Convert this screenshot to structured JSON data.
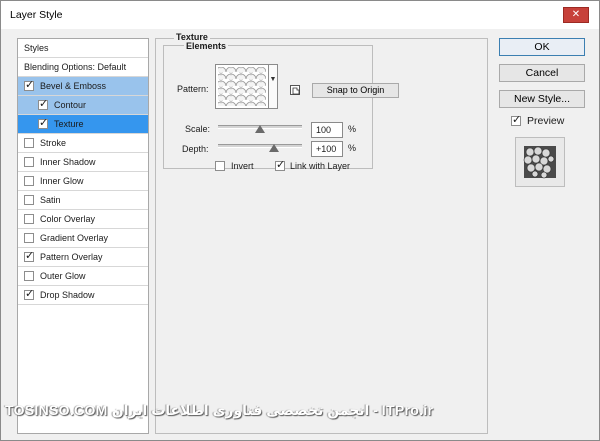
{
  "window": {
    "title": "Layer Style",
    "close_label": "✕"
  },
  "styles_panel": {
    "header": "Styles",
    "blending": "Blending Options: Default",
    "items": [
      {
        "label": "Bevel & Emboss",
        "checked": true,
        "indent": 0,
        "state": "selected-light"
      },
      {
        "label": "Contour",
        "checked": true,
        "indent": 1,
        "state": "selected-light"
      },
      {
        "label": "Texture",
        "checked": true,
        "indent": 1,
        "state": "selected"
      },
      {
        "label": "Stroke",
        "checked": false,
        "indent": 0,
        "state": ""
      },
      {
        "label": "Inner Shadow",
        "checked": false,
        "indent": 0,
        "state": ""
      },
      {
        "label": "Inner Glow",
        "checked": false,
        "indent": 0,
        "state": ""
      },
      {
        "label": "Satin",
        "checked": false,
        "indent": 0,
        "state": ""
      },
      {
        "label": "Color Overlay",
        "checked": false,
        "indent": 0,
        "state": ""
      },
      {
        "label": "Gradient Overlay",
        "checked": false,
        "indent": 0,
        "state": ""
      },
      {
        "label": "Pattern Overlay",
        "checked": true,
        "indent": 0,
        "state": ""
      },
      {
        "label": "Outer Glow",
        "checked": false,
        "indent": 0,
        "state": ""
      },
      {
        "label": "Drop Shadow",
        "checked": true,
        "indent": 0,
        "state": ""
      }
    ]
  },
  "texture": {
    "group_title": "Texture",
    "elements_title": "Elements",
    "pattern_label": "Pattern:",
    "snap_button": "Snap to Origin",
    "scale_label": "Scale:",
    "scale_value": "100",
    "scale_percent": 100,
    "depth_label": "Depth:",
    "depth_value": "+100",
    "depth_percent": 100,
    "percent_sign": "%",
    "invert_label": "Invert",
    "invert_checked": false,
    "link_label": "Link with Layer",
    "link_checked": true
  },
  "buttons": {
    "ok": "OK",
    "cancel": "Cancel",
    "new_style": "New Style..."
  },
  "preview": {
    "label": "Preview",
    "checked": true
  },
  "watermark": {
    "text": "TOSINSO.COM انجمن تخصصی فناوری اطلاعات ایران - ITPro.ir"
  },
  "colors": {
    "selection": "#3596ee",
    "selection_light": "#99c3ec",
    "accent_border": "#3c7fb1"
  }
}
